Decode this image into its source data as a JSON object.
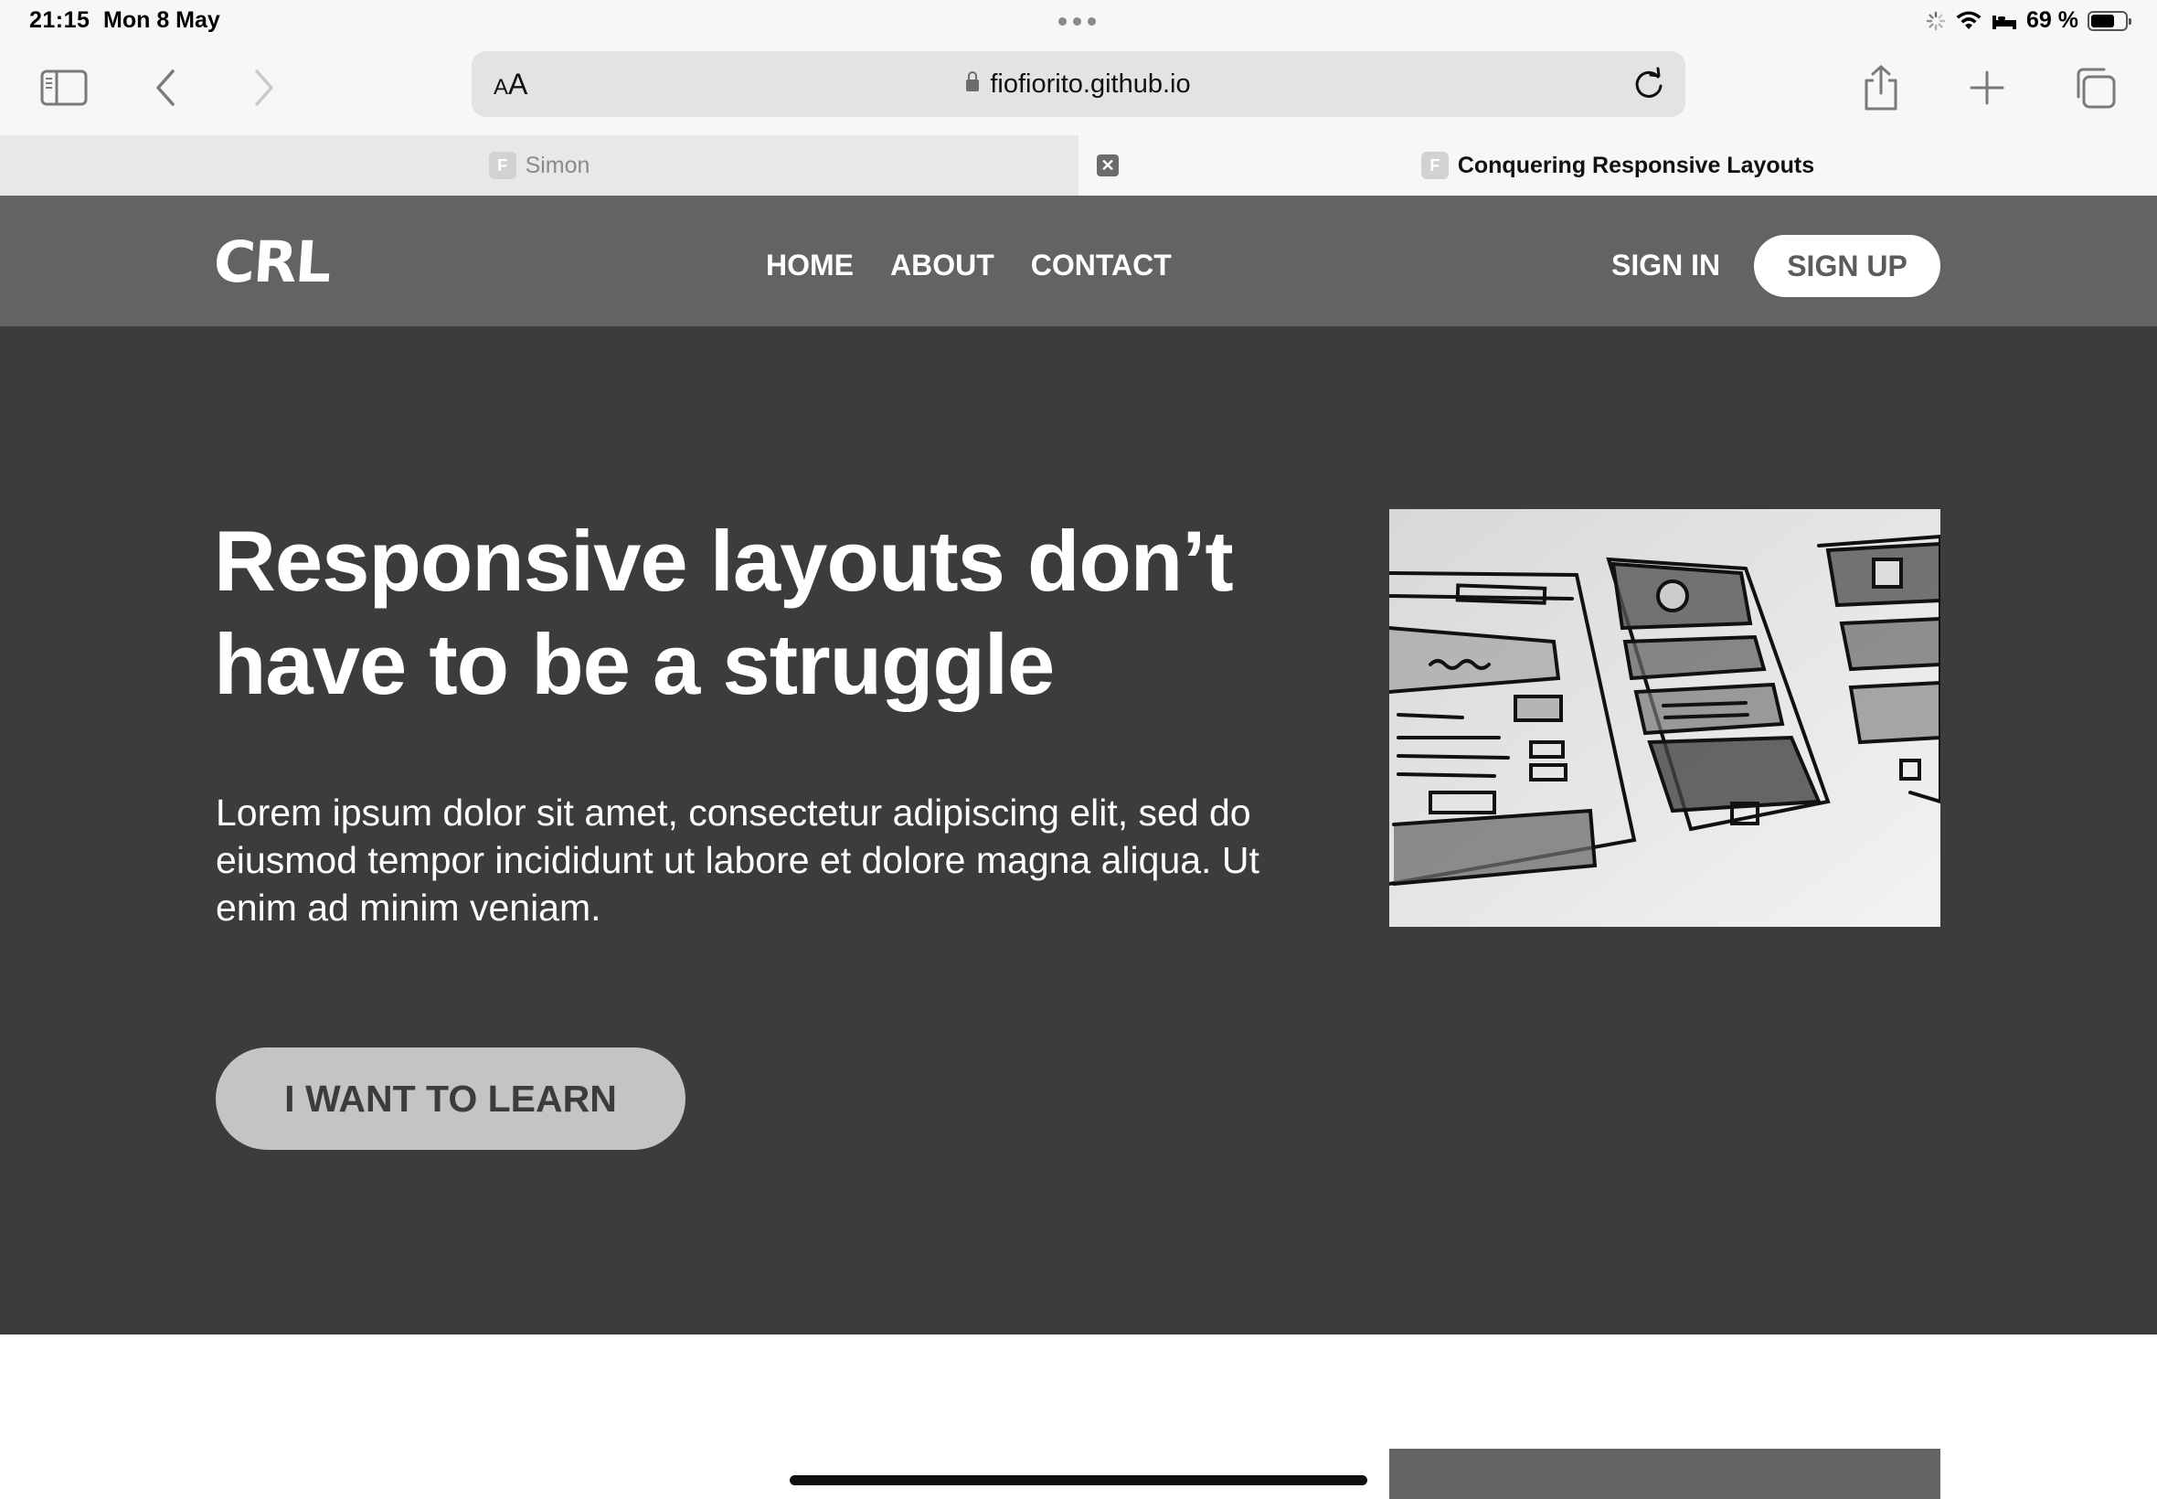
{
  "status_bar": {
    "time": "21:15",
    "date": "Mon 8 May",
    "battery_text": "69 %",
    "battery_level": 0.69
  },
  "browser": {
    "text_size_label": "AA",
    "url": "fiofiorito.github.io",
    "tabs": [
      {
        "favicon": "F",
        "title": "Simon",
        "active": false
      },
      {
        "favicon": "F",
        "title": "Conquering Responsive Layouts",
        "active": true
      }
    ]
  },
  "site": {
    "logo": "CRL",
    "nav": [
      "HOME",
      "ABOUT",
      "CONTACT"
    ],
    "sign_in": "SIGN IN",
    "sign_up": "SIGN UP"
  },
  "hero": {
    "title": "Responsive layouts don’t have to be a struggle",
    "body": "Lorem ipsum dolor sit amet, consectetur adipiscing elit, sed do eiusmod tempor incididunt ut labore et dolore magna aliqua. Ut enim ad minim veniam.",
    "cta": "I WANT TO LEARN"
  },
  "colors": {
    "nav_bg": "#636363",
    "hero_bg": "#3c3c3c",
    "cta_bg": "#c4c4c4",
    "browser_bg": "#f7f7f7"
  }
}
